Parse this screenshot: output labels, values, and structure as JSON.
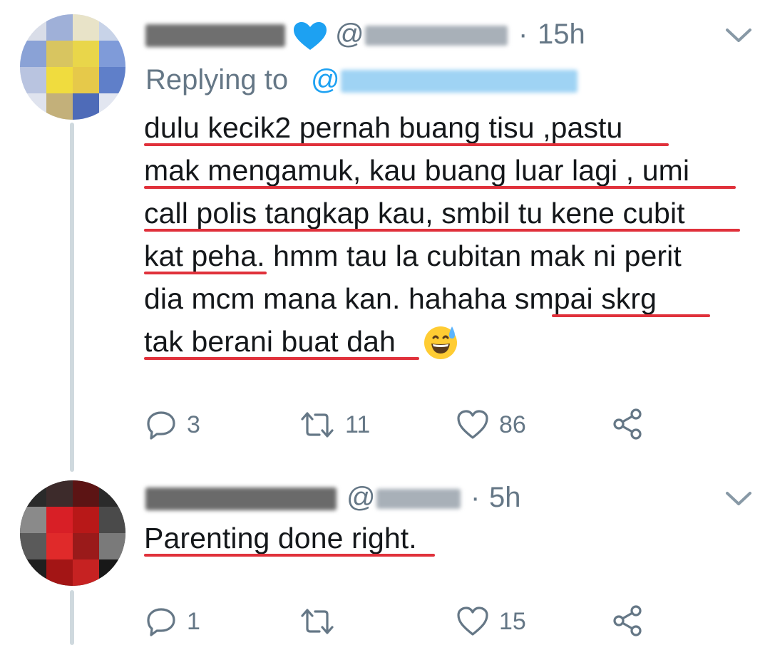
{
  "tweet1": {
    "display_name_hidden": "",
    "handle_prefix": "@",
    "separator": "·",
    "time": "15h",
    "reply_prefix": "Replying to",
    "reply_at": "@",
    "body_lines": [
      "dulu kecik2 pernah buang tisu ,pastu",
      "mak mengamuk, kau buang luar lagi , umi",
      "call polis tangkap kau, smbil tu kene cubit",
      "kat peha. hmm tau la cubitan mak ni perit",
      "dia mcm mana kan. hahaha smpai skrg",
      "tak berani buat dah"
    ],
    "emoji": "grinning-face-with-sweat",
    "actions": {
      "replies": "3",
      "retweets": "11",
      "likes": "86"
    }
  },
  "tweet2": {
    "handle_prefix": "@",
    "separator": "·",
    "time": "5h",
    "body_lines": [
      "Parenting done right."
    ],
    "actions": {
      "replies": "1",
      "retweets": "",
      "likes": "15"
    }
  },
  "colors": {
    "text": "#14171a",
    "muted": "#657786",
    "link": "#1da1f2",
    "verified": "#1da1f2",
    "underline": "#e0313b",
    "thread_line": "#cfd9de"
  },
  "icons": {
    "reply": "reply-icon",
    "retweet": "retweet-icon",
    "like": "heart-icon",
    "share": "share-icon",
    "more": "chevron-down-icon",
    "verified": "verified-heart-icon"
  }
}
